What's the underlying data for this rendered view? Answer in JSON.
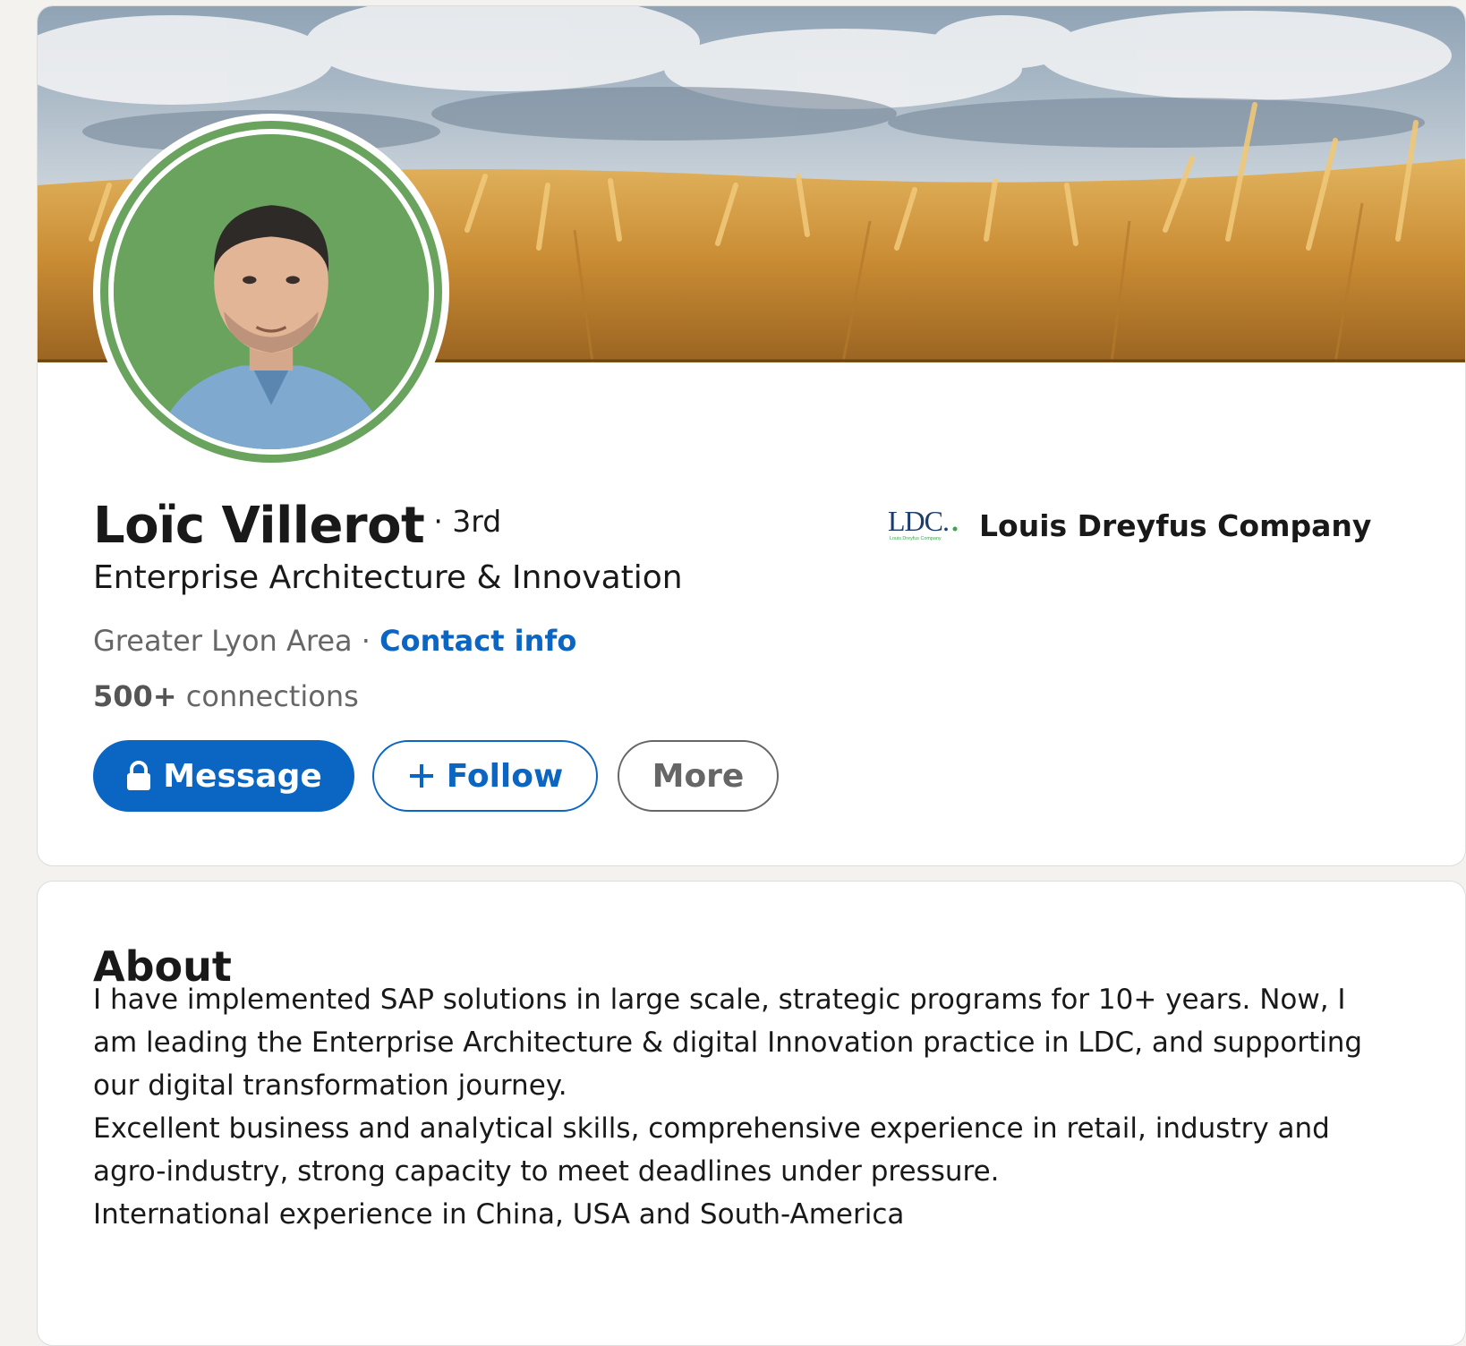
{
  "profile": {
    "name": "Loïc Villerot",
    "degree": "· 3rd",
    "headline": "Enterprise Architecture & Innovation",
    "location": "Greater Lyon Area",
    "location_separator": " · ",
    "contact_info": "Contact info",
    "connections_count": "500+",
    "connections_label": " connections",
    "avatar_ring_color": "#6aa35e"
  },
  "actions": {
    "message_label": "Message",
    "follow_label": "Follow",
    "more_label": "More",
    "accent_color": "#0a66c2"
  },
  "company": {
    "logo_text": "LDC.",
    "logo_subtext": "Louis Dreyfus Company",
    "name": "Louis Dreyfus Company"
  },
  "about": {
    "title": "About",
    "paragraphs": [
      "I have implemented SAP solutions in large scale, strategic programs for 10+ years. Now, I am leading the Enterprise Architecture & digital Innovation practice in LDC, and supporting our digital transformation journey.",
      "Excellent business and analytical skills, comprehensive experience in retail, industry and agro-industry, strong capacity to meet deadlines under pressure.",
      "International experience in China, USA and South-America"
    ]
  }
}
